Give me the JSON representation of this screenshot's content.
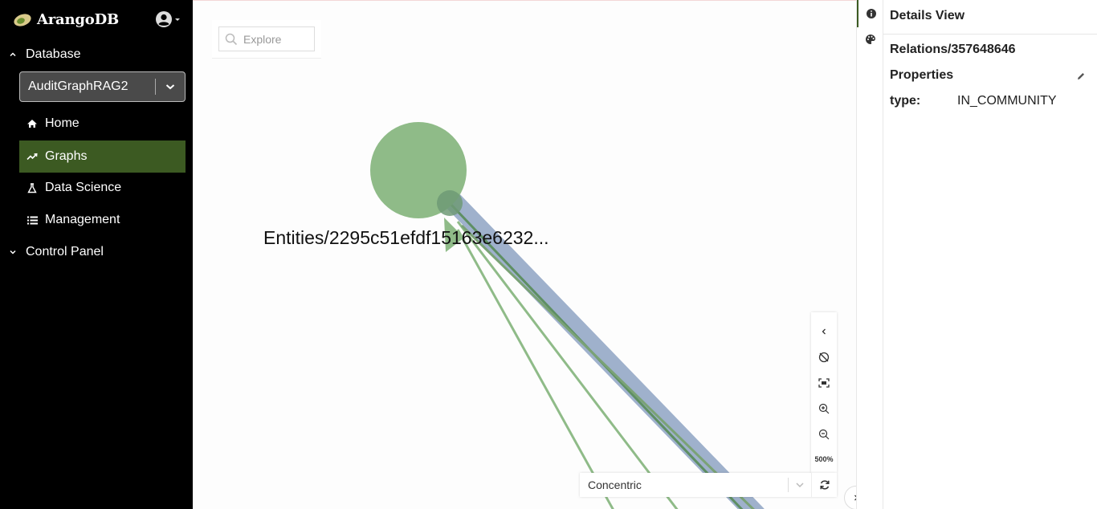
{
  "sidebar": {
    "brand": "ArangoDB",
    "sections": {
      "database": "Database",
      "control_panel": "Control Panel"
    },
    "database_select": {
      "value": "AuditGraphRAG2"
    },
    "nav": [
      {
        "label": "Home",
        "icon": "home-icon"
      },
      {
        "label": "Graphs",
        "icon": "graphs-icon",
        "active": true
      },
      {
        "label": "Data Science",
        "icon": "flask-icon"
      },
      {
        "label": "Management",
        "icon": "list-icon"
      }
    ]
  },
  "canvas": {
    "search": {
      "placeholder": "Explore"
    },
    "node_label": "Entities/2295c51efdf15163e6232...",
    "colors": {
      "node": "#8fbb88",
      "edge_green": "#8fbb88",
      "edge_dark_green": "#5e8f63",
      "edge_selected": "#9fb1cc"
    },
    "tools": {
      "icons": [
        "chevron-left-icon",
        "hide-icon",
        "fit-screen-icon",
        "zoom-in-icon",
        "zoom-out-icon"
      ],
      "zoom_level": "500%"
    },
    "layout": {
      "value": "Concentric"
    }
  },
  "details": {
    "title": "Details View",
    "id": "Relations/357648646",
    "properties_title": "Properties",
    "properties": [
      {
        "key": "type:",
        "value": "IN_COMMUNITY"
      }
    ]
  },
  "colors": {
    "accent": "#3c5a22",
    "sidebar_bg": "#000000"
  }
}
